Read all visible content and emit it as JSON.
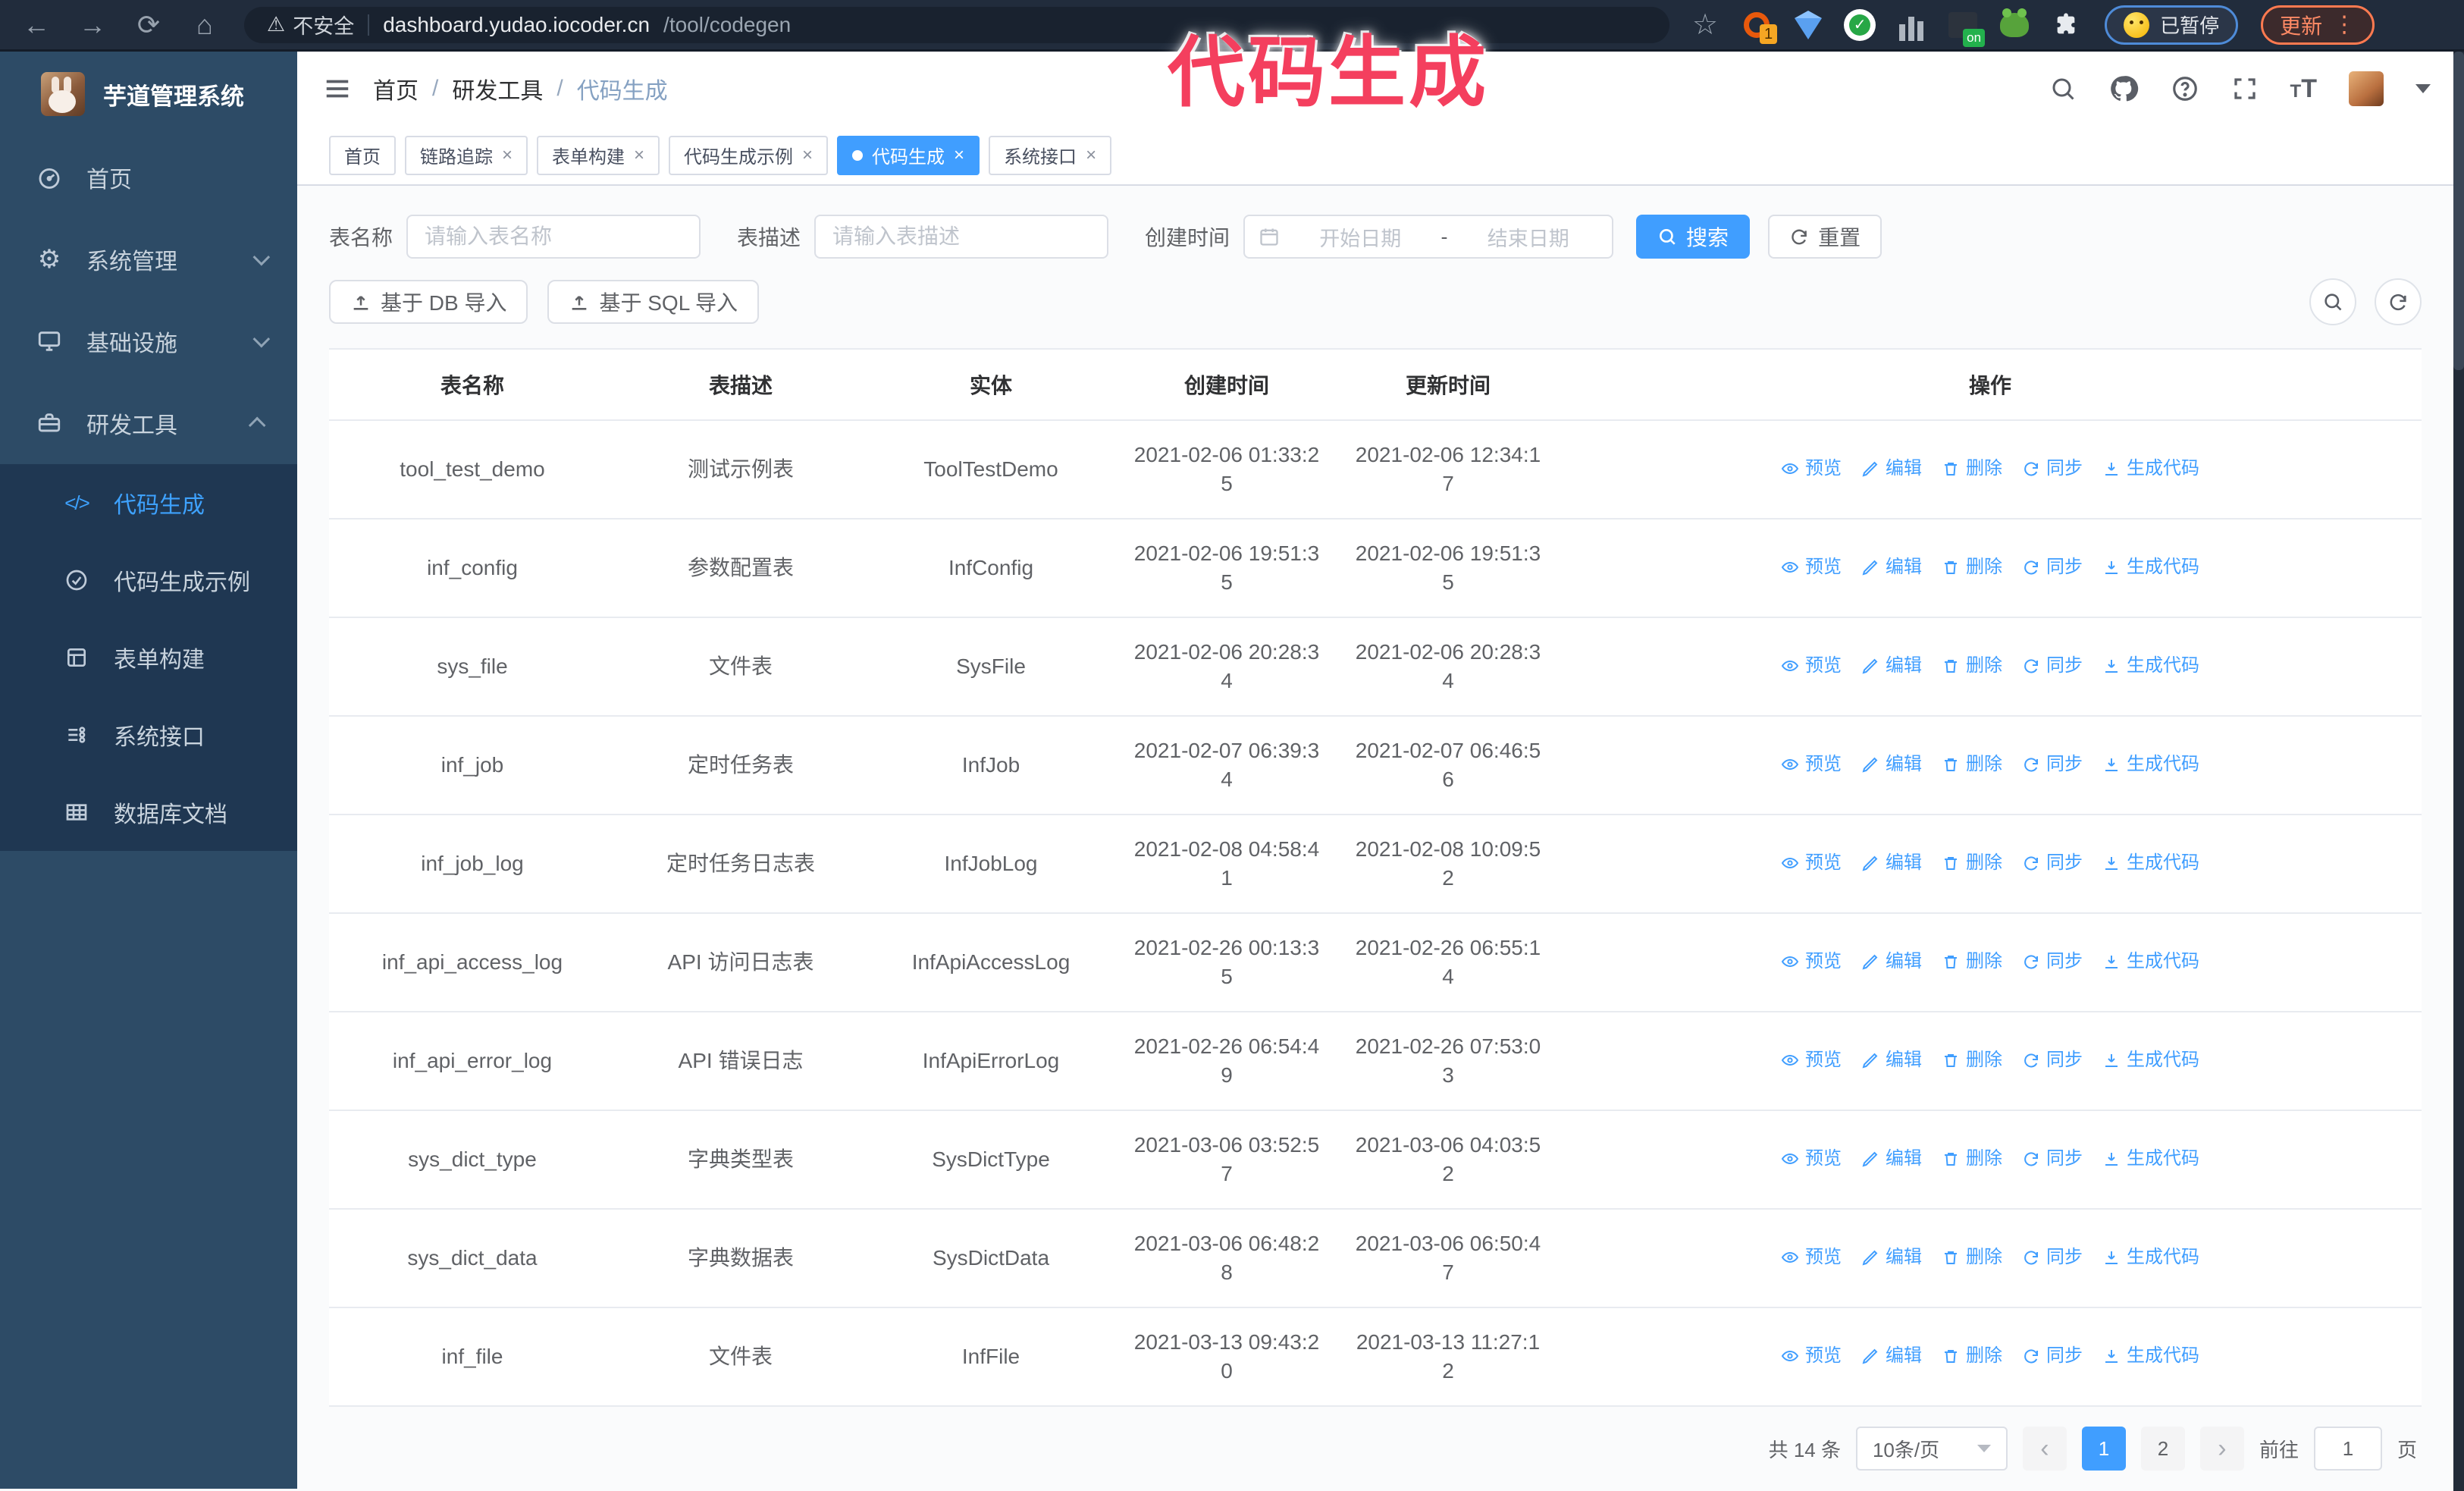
{
  "annotation": {
    "text": "代码生成",
    "color": "#f43f5e"
  },
  "browser": {
    "security_label": "不安全",
    "url_host": "dashboard.yudao.iocoder.cn",
    "url_path": "/tool/codegen",
    "extension_badge": "1",
    "extension_on_badge": "on",
    "paused_badge": "已暂停",
    "update_button": "更新"
  },
  "sidebar": {
    "logo_title": "芋道管理系统",
    "items": [
      {
        "label": "首页"
      },
      {
        "label": "系统管理",
        "chevron": "down"
      },
      {
        "label": "基础设施",
        "chevron": "down"
      },
      {
        "label": "研发工具",
        "chevron": "up"
      }
    ],
    "submenu": [
      {
        "label": "代码生成",
        "active": true
      },
      {
        "label": "代码生成示例"
      },
      {
        "label": "表单构建"
      },
      {
        "label": "系统接口"
      },
      {
        "label": "数据库文档"
      }
    ]
  },
  "breadcrumb": {
    "items": [
      "首页",
      "研发工具",
      "代码生成"
    ]
  },
  "tabs": [
    {
      "label": "首页",
      "closable": false
    },
    {
      "label": "链路追踪",
      "closable": true
    },
    {
      "label": "表单构建",
      "closable": true
    },
    {
      "label": "代码生成示例",
      "closable": true
    },
    {
      "label": "代码生成",
      "closable": true,
      "active": true
    },
    {
      "label": "系统接口",
      "closable": true
    }
  ],
  "filters": {
    "table_name_label": "表名称",
    "table_name_placeholder": "请输入表名称",
    "table_desc_label": "表描述",
    "table_desc_placeholder": "请输入表描述",
    "create_time_label": "创建时间",
    "date_start_placeholder": "开始日期",
    "date_separator": "-",
    "date_end_placeholder": "结束日期",
    "search_button": "搜索",
    "reset_button": "重置"
  },
  "toolbar": {
    "import_db": "基于 DB 导入",
    "import_sql": "基于 SQL 导入"
  },
  "table": {
    "columns": [
      "表名称",
      "表描述",
      "实体",
      "创建时间",
      "更新时间",
      "操作"
    ],
    "row_actions": [
      {
        "label": "预览",
        "icon": "eye-icon"
      },
      {
        "label": "编辑",
        "icon": "edit-icon"
      },
      {
        "label": "删除",
        "icon": "delete-icon"
      },
      {
        "label": "同步",
        "icon": "sync-icon"
      },
      {
        "label": "生成代码",
        "icon": "download-icon"
      }
    ],
    "rows": [
      {
        "name": "tool_test_demo",
        "desc": "测试示例表",
        "entity": "ToolTestDemo",
        "created": "2021-02-06 01:33:25",
        "updated": "2021-02-06 12:34:17"
      },
      {
        "name": "inf_config",
        "desc": "参数配置表",
        "entity": "InfConfig",
        "created": "2021-02-06 19:51:35",
        "updated": "2021-02-06 19:51:35"
      },
      {
        "name": "sys_file",
        "desc": "文件表",
        "entity": "SysFile",
        "created": "2021-02-06 20:28:34",
        "updated": "2021-02-06 20:28:34"
      },
      {
        "name": "inf_job",
        "desc": "定时任务表",
        "entity": "InfJob",
        "created": "2021-02-07 06:39:34",
        "updated": "2021-02-07 06:46:56"
      },
      {
        "name": "inf_job_log",
        "desc": "定时任务日志表",
        "entity": "InfJobLog",
        "created": "2021-02-08 04:58:41",
        "updated": "2021-02-08 10:09:52"
      },
      {
        "name": "inf_api_access_log",
        "desc": "API 访问日志表",
        "entity": "InfApiAccessLog",
        "created": "2021-02-26 00:13:35",
        "updated": "2021-02-26 06:55:14"
      },
      {
        "name": "inf_api_error_log",
        "desc": "API 错误日志",
        "entity": "InfApiErrorLog",
        "created": "2021-02-26 06:54:49",
        "updated": "2021-02-26 07:53:03"
      },
      {
        "name": "sys_dict_type",
        "desc": "字典类型表",
        "entity": "SysDictType",
        "created": "2021-03-06 03:52:57",
        "updated": "2021-03-06 04:03:52"
      },
      {
        "name": "sys_dict_data",
        "desc": "字典数据表",
        "entity": "SysDictData",
        "created": "2021-03-06 06:48:28",
        "updated": "2021-03-06 06:50:47"
      },
      {
        "name": "inf_file",
        "desc": "文件表",
        "entity": "InfFile",
        "created": "2021-03-13 09:43:20",
        "updated": "2021-03-13 11:27:12"
      }
    ]
  },
  "pagination": {
    "total_text": "共 14 条",
    "page_size": "10条/页",
    "pages": [
      {
        "label": "1",
        "active": true
      },
      {
        "label": "2"
      }
    ],
    "goto_label": "前往",
    "goto_value": "1",
    "page_unit": "页"
  },
  "colors": {
    "accent": "#409eff",
    "sidebar": "#2d4b66",
    "submenu": "#1f3752",
    "chrome": "#212c3c",
    "annotation": "#f43f5e"
  }
}
